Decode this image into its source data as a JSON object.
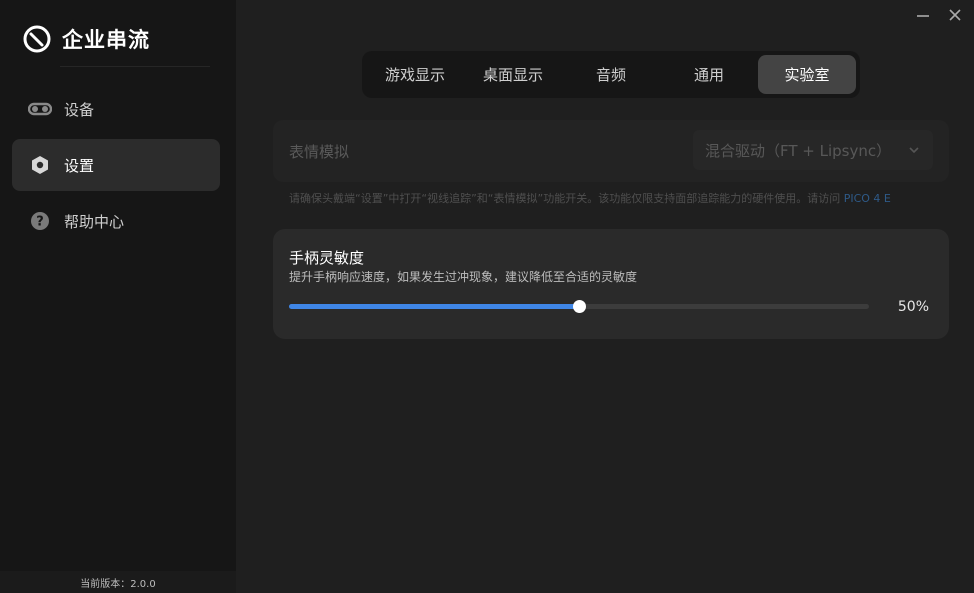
{
  "app": {
    "name": "企业串流",
    "version": "当前版本：2.0.0"
  },
  "sidebar": {
    "items": [
      {
        "label": "设备",
        "icon": "goggles-icon",
        "active": false
      },
      {
        "label": "设置",
        "icon": "settings-hex-icon",
        "active": true
      },
      {
        "label": "帮助中心",
        "icon": "help-circle-icon",
        "active": false
      }
    ]
  },
  "tabs": [
    {
      "label": "游戏显示",
      "active": false
    },
    {
      "label": "桌面显示",
      "active": false
    },
    {
      "label": "音频",
      "active": false
    },
    {
      "label": "通用",
      "active": false
    },
    {
      "label": "实验室",
      "active": true
    }
  ],
  "expression": {
    "label": "表情模拟",
    "select_value": "混合驱动（FT + Lipsync）",
    "note": "请确保头戴端“设置”中打开“视线追踪”和“表情模拟”功能开关。该功能仅限支持面部追踪能力的硬件使用。请访问 ",
    "note_link": "PICO 4 E"
  },
  "sensitivity": {
    "title": "手柄灵敏度",
    "description": "提升手柄响应速度，如果发生过冲现象，建议降低至合适的灵敏度",
    "value": 50,
    "value_label": "50%"
  },
  "colors": {
    "accent": "#3f86e6",
    "sidebar_bg": "#161616",
    "main_bg": "#1f1f1f"
  }
}
